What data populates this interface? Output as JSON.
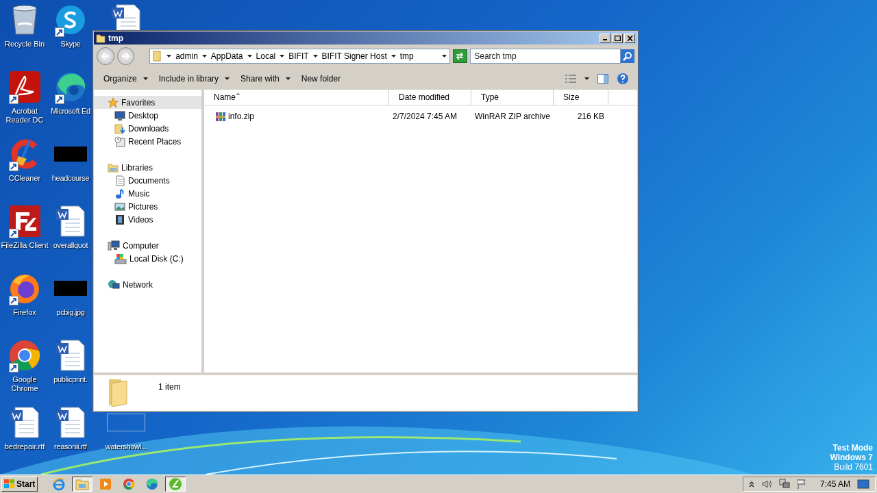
{
  "desktop": {
    "columns": [
      [
        {
          "kind": "recycle",
          "label": "Recycle Bin",
          "shortcut": false
        },
        {
          "kind": "acrobat",
          "label": "Acrobat Reader DC",
          "shortcut": true
        },
        {
          "kind": "ccleaner",
          "label": "CCleaner",
          "shortcut": true
        },
        {
          "kind": "filezilla",
          "label": "FileZilla Client",
          "shortcut": true
        },
        {
          "kind": "firefox",
          "label": "Firefox",
          "shortcut": true
        },
        {
          "kind": "chrome",
          "label": "Google Chrome",
          "shortcut": true
        },
        {
          "kind": "word",
          "label": "bedrepair.rtf",
          "shortcut": false
        }
      ],
      [
        {
          "kind": "skype",
          "label": "Skype",
          "shortcut": true
        },
        {
          "kind": "edge",
          "label": "Microsoft Ed",
          "shortcut": true
        },
        {
          "kind": "dark-image",
          "label": "headcourse",
          "shortcut": false
        },
        {
          "kind": "word",
          "label": "overallquot",
          "shortcut": false
        },
        {
          "kind": "dark-image",
          "label": "pcbig.jpg",
          "shortcut": false
        },
        {
          "kind": "word",
          "label": "publicprint.",
          "shortcut": false
        },
        {
          "kind": "word",
          "label": "reasonii.rtf",
          "shortcut": false
        }
      ],
      [
        {
          "kind": "word",
          "shortcut": false
        },
        {
          "kind": "empty"
        },
        {
          "kind": "empty"
        },
        {
          "kind": "empty"
        },
        {
          "kind": "empty"
        },
        {
          "kind": "empty"
        },
        {
          "kind": "blank-image",
          "label": "watershowl...",
          "shortcut": false
        }
      ]
    ],
    "system_text": [
      "Test Mode",
      "Windows 7",
      "Build 7601"
    ]
  },
  "window": {
    "title": "tmp",
    "breadcrumb": [
      "admin",
      "AppData",
      "Local",
      "BIFIT",
      "BIFIT Signer Host",
      "tmp"
    ],
    "search": {
      "placeholder": "Search tmp"
    },
    "toolbar": [
      {
        "label": "Organize",
        "has_menu": true
      },
      {
        "label": "Include in library",
        "has_menu": true
      },
      {
        "label": "Share with",
        "has_menu": true
      },
      {
        "label": "New folder",
        "has_menu": false
      }
    ],
    "nav": [
      {
        "label": "Favorites",
        "selected": true,
        "children": [
          {
            "label": "Desktop",
            "selected": false
          },
          {
            "label": "Downloads",
            "selected": false
          },
          {
            "label": "Recent Places",
            "selected": false
          }
        ]
      },
      {
        "label": "Libraries",
        "selected": false,
        "children": [
          {
            "label": "Documents",
            "selected": false
          },
          {
            "label": "Music",
            "selected": false
          },
          {
            "label": "Pictures",
            "selected": false
          },
          {
            "label": "Videos",
            "selected": false
          }
        ]
      },
      {
        "label": "Computer",
        "selected": false,
        "children": [
          {
            "label": "Local Disk (C:)",
            "selected": false
          }
        ]
      },
      {
        "label": "Network",
        "selected": false
      }
    ],
    "table": {
      "columns": [
        {
          "label": "Name",
          "sorted": true
        },
        {
          "label": "Date modified",
          "sorted": false
        },
        {
          "label": "Type",
          "sorted": false
        },
        {
          "label": "Size",
          "sorted": false
        }
      ],
      "rows": [
        {
          "name": "info.zip",
          "date_modified": "2/7/2024 7:45 AM",
          "type": "WinRAR ZIP archive",
          "size": "216 KB"
        }
      ]
    },
    "details": {
      "summary": "1 item"
    }
  },
  "taskbar": {
    "start": "Start",
    "apps": [
      {
        "kind": "ie",
        "active": false
      },
      {
        "kind": "explorer",
        "active": true
      },
      {
        "kind": "media",
        "active": false
      },
      {
        "kind": "chrome",
        "active": false
      },
      {
        "kind": "edge",
        "active": false
      },
      {
        "kind": "green",
        "active": true
      }
    ],
    "time": "7:45 AM"
  }
}
